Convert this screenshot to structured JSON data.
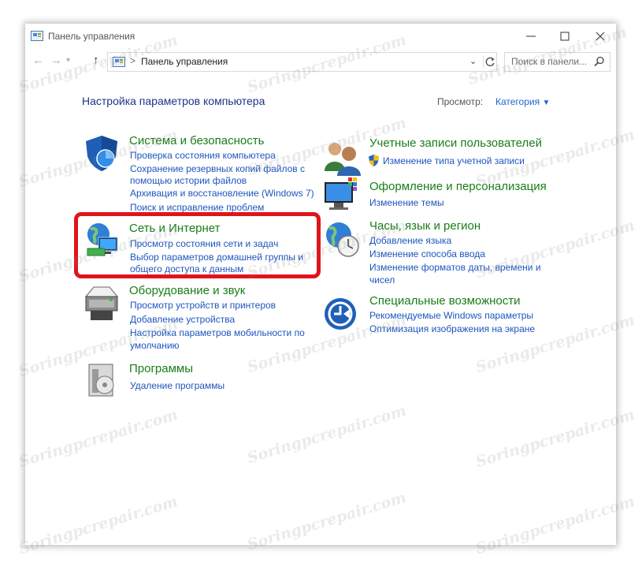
{
  "window": {
    "title": "Панель управления"
  },
  "address": {
    "path": "Панель управления",
    "separator": ">",
    "search_placeholder": "Поиск в панели..."
  },
  "header": {
    "title": "Настройка параметров компьютера",
    "view_label": "Просмотр:",
    "view_value": "Категория"
  },
  "categories": {
    "system": {
      "title": "Система и безопасность",
      "links": [
        "Проверка состояния компьютера",
        "Сохранение резервных копий файлов с",
        "помощью истории файлов",
        "Архивация и восстановление (Windows 7)",
        "Поиск и исправление проблем"
      ]
    },
    "network": {
      "title": "Сеть и Интернет",
      "links": [
        "Просмотр состояния сети и задач",
        "Выбор параметров домашней группы и",
        "общего доступа к данным"
      ]
    },
    "hardware": {
      "title": "Оборудование и звук",
      "links": [
        "Просмотр устройств и принтеров",
        "Добавление устройства",
        "Настройка параметров мобильности по",
        "умолчанию"
      ]
    },
    "programs": {
      "title": "Программы",
      "links": [
        "Удаление программы"
      ]
    },
    "accounts": {
      "title": "Учетные записи пользователей",
      "links": [
        "Изменение типа учетной записи"
      ]
    },
    "appearance": {
      "title": "Оформление и персонализация",
      "links": [
        "Изменение темы"
      ]
    },
    "clock": {
      "title": "Часы, язык и регион",
      "links": [
        "Добавление языка",
        "Изменение способа ввода",
        "Изменение форматов даты, времени и",
        "чисел"
      ]
    },
    "ease": {
      "title": "Специальные возможности",
      "links": [
        "Рекомендуемые Windows параметры",
        "Оптимизация изображения на экране"
      ]
    }
  },
  "watermark": "Soringpcrepair.com",
  "colors": {
    "heading": "#1e3287",
    "category_title": "#1a7d1a",
    "link": "#1e55bf",
    "highlight": "#e0141a"
  }
}
